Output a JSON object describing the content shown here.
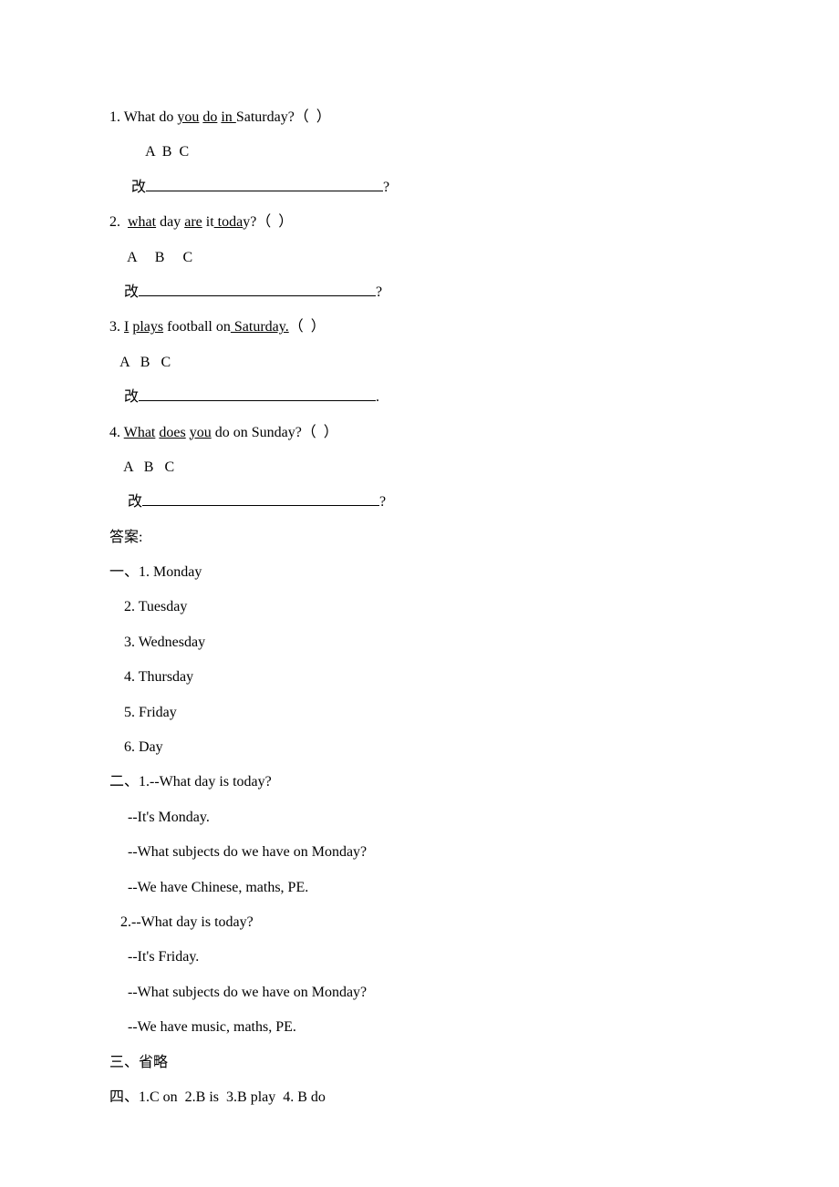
{
  "q1": {
    "pre": "1. What do ",
    "u1": "you",
    "mid1": " ",
    "u2": "do",
    "mid2": " ",
    "u3": "in ",
    "post": "Saturday?（  ）",
    "abc": "          A  B  C",
    "fill_label": "      改",
    "fill_end": "?"
  },
  "q2": {
    "pre": "2.  ",
    "u1": "what",
    "mid1": " day ",
    "u2": "are",
    "mid2": " it",
    "u3": " toda",
    "post": "y?（  ）",
    "abc": "     A     B     C",
    "fill_label": "    改",
    "fill_end": "?"
  },
  "q3": {
    "pre": "3. ",
    "u1": "I",
    "mid1": " ",
    "u2": "plays",
    "mid2": " football on",
    "u3": " Saturday.",
    "post": "（  ）",
    "abc": "   A   B   C",
    "fill_label": "    改",
    "fill_end": "."
  },
  "q4": {
    "pre": "4. ",
    "u1": "What",
    "mid1": " ",
    "u2": "does",
    "mid2": " ",
    "u3": "you",
    "post": " do on Sunday?（  ）",
    "abc": "    A   B   C",
    "fill_label": "     改",
    "fill_end": "?"
  },
  "answers_header": "答案:",
  "section1": "一、1. Monday\n    2. Tuesday\n    3. Wednesday\n    4. Thursday\n    5. Friday\n    6. Day",
  "section2": "二、1.--What day is today?\n     --It's Monday.\n     --What subjects do we have on Monday?\n     --We have Chinese, maths, PE.\n   2.--What day is today?\n     --It's Friday.\n     --What subjects do we have on Monday?\n     --We have music, maths, PE.",
  "section3": "三、省略",
  "section4": "四、1.C on  2.B is  3.B play  4. B do"
}
